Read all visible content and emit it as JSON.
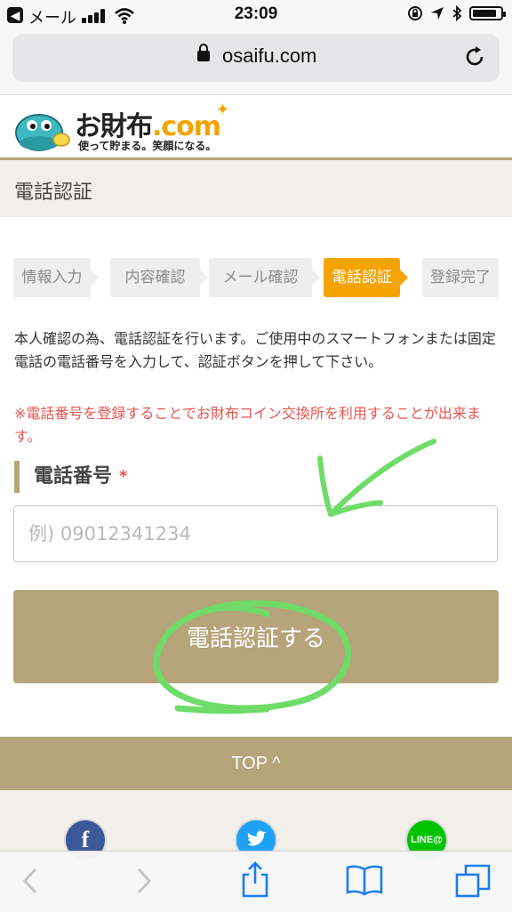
{
  "status_bar": {
    "back_glyph": "◀",
    "carrier": "メール",
    "time": "23:09",
    "icons": [
      "signal-icon",
      "wifi-icon",
      "orientation-lock-icon",
      "location-icon",
      "bluetooth-icon",
      "battery-icon"
    ],
    "battery_level": 0.85
  },
  "browser": {
    "url": "osaifu.com"
  },
  "site": {
    "logo_text": "お財布",
    "logo_suffix": ".com",
    "logo_tagline": "使って貯まる。笑顔になる。"
  },
  "page": {
    "title": "電話認証",
    "steps": [
      {
        "label": "情報入力",
        "active": false
      },
      {
        "label": "内容確認",
        "active": false
      },
      {
        "label": "メール確認",
        "active": false
      },
      {
        "label": "電話認証",
        "active": true
      },
      {
        "label": "登録完了",
        "active": false
      }
    ],
    "description": "本人確認の為、電話認証を行います。ご使用中のスマートフォンまたは固定電話の電話番号を入力して、認証ボタンを押して下さい。",
    "warning": "※電話番号を登録することでお財布コイン交換所を利用することが出来ます。",
    "field_label": "電話番号",
    "required_mark": "*",
    "phone_placeholder": "例) 09012341234",
    "phone_value": "",
    "submit_label": "電話認証する"
  },
  "footer": {
    "top_link": "TOP ^",
    "social": [
      {
        "name": "facebook",
        "glyph": "f"
      },
      {
        "name": "twitter",
        "glyph": ""
      },
      {
        "name": "line",
        "glyph": "LINE@"
      }
    ]
  },
  "colors": {
    "accent_gold": "#b6a47a",
    "active_step": "#f4a300",
    "warning_red": "#e8544e",
    "annotation_green": "#6fdc6a"
  }
}
